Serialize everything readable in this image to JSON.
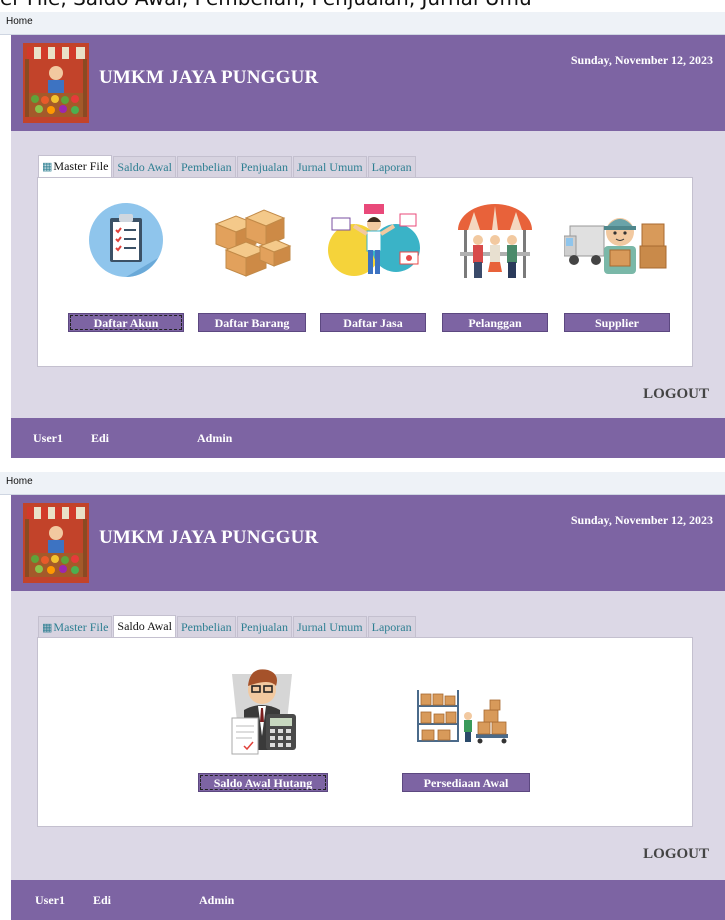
{
  "top_cut_text": "er File, Saldo Awal, Pembelian, Penjualan, Jurnal Umu",
  "windows": [
    {
      "title": "Home",
      "app_title": "UMKM JAYA PUNGGUR",
      "date": "Sunday, November 12, 2023",
      "tabs": [
        "Master File",
        "Saldo Awal",
        "Pembelian",
        "Penjualan",
        "Jurnal Umum",
        "Laporan"
      ],
      "active_tab": "Master File",
      "buttons": [
        "Daftar Akun",
        "Daftar Barang",
        "Daftar Jasa",
        "Pelanggan",
        "Supplier"
      ],
      "logout": "LOGOUT",
      "footer": {
        "username": "User1",
        "name": "Edi",
        "role": "Admin"
      }
    },
    {
      "title": "Home",
      "app_title": "UMKM JAYA PUNGGUR",
      "date": "Sunday, November 12, 2023",
      "tabs": [
        "Master File",
        "Saldo Awal",
        "Pembelian",
        "Penjualan",
        "Jurnal Umum",
        "Laporan"
      ],
      "active_tab": "Saldo Awal",
      "buttons": [
        "Saldo Awal Hutang",
        "Persediaan Awal"
      ],
      "logout": "LOGOUT",
      "footer": {
        "username": "User1",
        "name": "Edi",
        "role": "Admin"
      }
    }
  ],
  "icons": {
    "tab_master_file": "table-icon",
    "master_file_items": [
      "clipboard-checklist-icon",
      "boxes-icon",
      "service-worker-icon",
      "customers-icon",
      "delivery-courier-icon"
    ],
    "saldo_awal_items": [
      "accountant-icon",
      "warehouse-inventory-icon"
    ],
    "logo": "market-stall-logo-icon"
  },
  "colors": {
    "header": "#7d64a3",
    "frame": "#dcd8e6",
    "tab_text": "#2e7f92"
  }
}
